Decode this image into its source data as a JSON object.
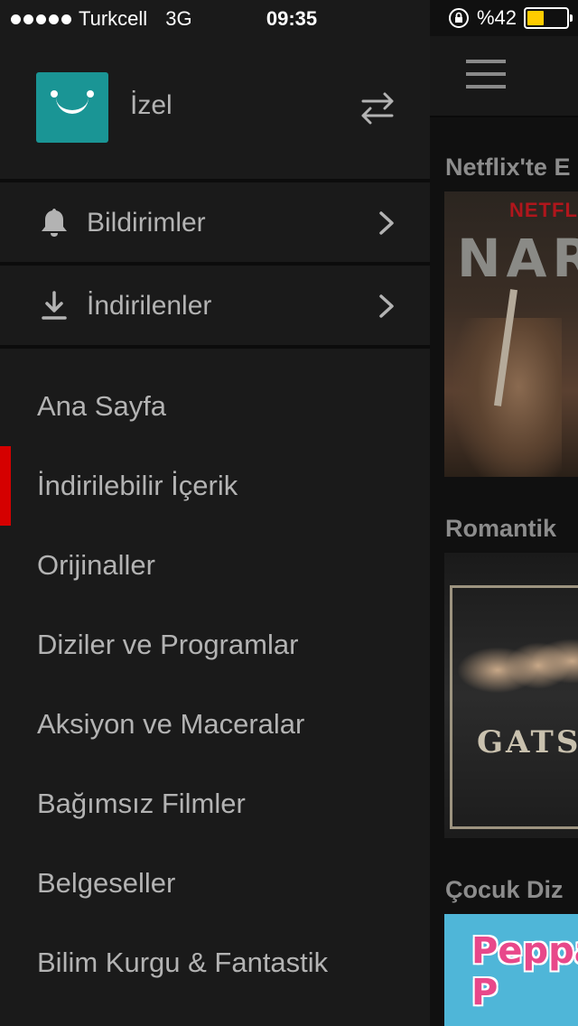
{
  "status_bar": {
    "carrier": "Turkcell",
    "network": "3G",
    "time": "09:35",
    "battery_percent": "%42",
    "battery_level": 0.42,
    "battery_color": "#ffcc00",
    "icons": [
      "signal-dots-icon",
      "orientation-lock-icon",
      "battery-icon"
    ]
  },
  "drawer": {
    "profile": {
      "name": "İzel",
      "avatar_color": "#1a9595",
      "switch_icon": "switch-profile-icon"
    },
    "menu_rows": [
      {
        "label": "Bildirimler",
        "icon": "bell-icon"
      },
      {
        "label": "İndirilenler",
        "icon": "download-icon"
      }
    ],
    "nav_items": [
      {
        "label": "Ana Sayfa",
        "active": false
      },
      {
        "label": "İndirilebilir İçerik",
        "active": true
      },
      {
        "label": "Orijinaller",
        "active": false
      },
      {
        "label": "Diziler ve Programlar",
        "active": false
      },
      {
        "label": "Aksiyon ve Maceralar",
        "active": false
      },
      {
        "label": "Bağımsız Filmler",
        "active": false
      },
      {
        "label": "Belgeseller",
        "active": false
      },
      {
        "label": "Bilim Kurgu & Fantastik",
        "active": false
      }
    ],
    "active_indicator_color": "#d50000"
  },
  "content": {
    "rows": [
      {
        "title": "Netflix'te E"
      },
      {
        "title": "Romantik"
      },
      {
        "title": "Çocuk Diz"
      }
    ],
    "posters": [
      {
        "brand": "NETFLIX",
        "title": "NARC"
      },
      {
        "title": "GATSI"
      },
      {
        "title": "Peppa P"
      }
    ]
  }
}
